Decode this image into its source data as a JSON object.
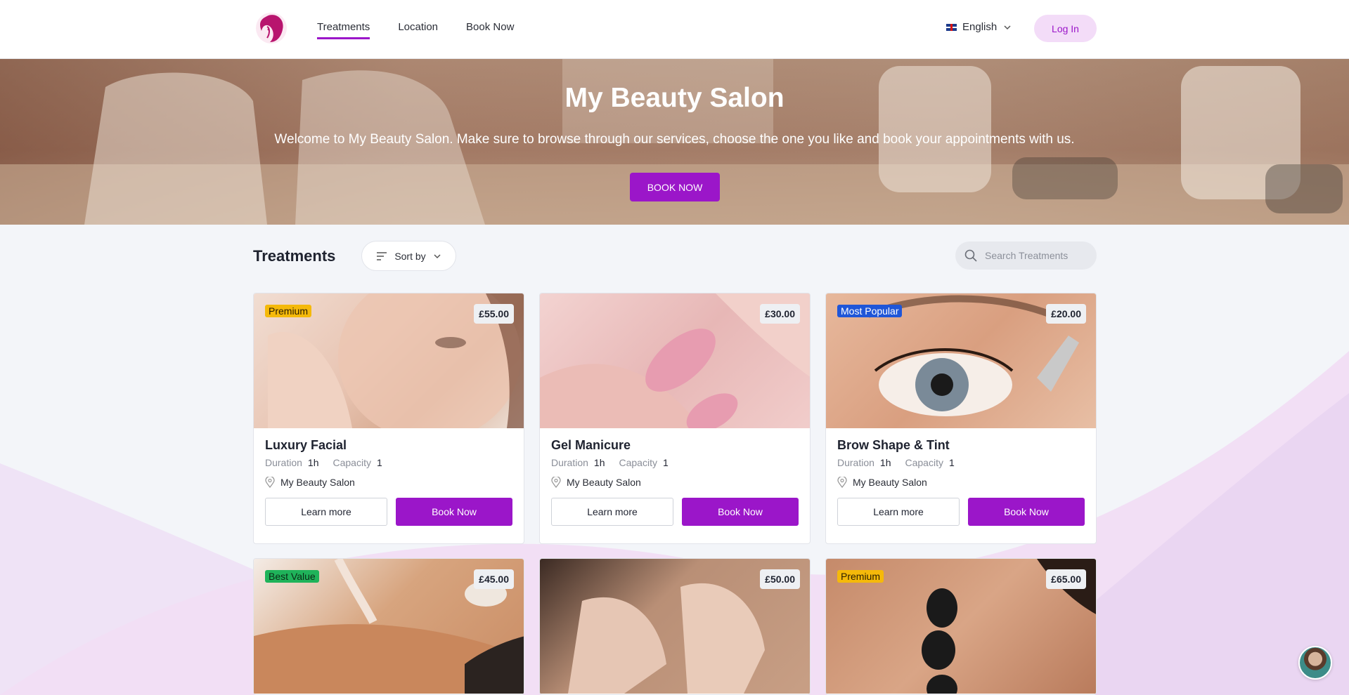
{
  "header": {
    "nav": [
      {
        "label": "Treatments",
        "active": true
      },
      {
        "label": "Location",
        "active": false
      },
      {
        "label": "Book Now",
        "active": false
      }
    ],
    "language": "English",
    "login_label": "Log In",
    "logo_icon": "woman-face-logo-icon"
  },
  "hero": {
    "title": "My Beauty Salon",
    "subtitle": "Welcome to My Beauty Salon. Make sure to browse through our services, choose the one you like and book your appointments with us.",
    "cta": "BOOK NOW"
  },
  "treatments": {
    "title": "Treatments",
    "sort_label": "Sort by",
    "search_placeholder": "Search Treatments",
    "cards": [
      {
        "name": "Luxury Facial",
        "price": "£55.00",
        "badge": "Premium",
        "badge_color": "#f5b90a",
        "duration_label": "Duration",
        "duration": "1h",
        "capacity_label": "Capacity",
        "capacity": "1",
        "location": "My Beauty Salon",
        "learn_label": "Learn more",
        "book_label": "Book Now"
      },
      {
        "name": "Gel Manicure",
        "price": "£30.00",
        "badge": "",
        "duration_label": "Duration",
        "duration": "1h",
        "capacity_label": "Capacity",
        "capacity": "1",
        "location": "My Beauty Salon",
        "learn_label": "Learn more",
        "book_label": "Book Now"
      },
      {
        "name": "Brow Shape & Tint",
        "price": "£20.00",
        "badge": "Most Popular",
        "badge_color": "#1f56d8",
        "duration_label": "Duration",
        "duration": "1h",
        "capacity_label": "Capacity",
        "capacity": "1",
        "location": "My Beauty Salon",
        "learn_label": "Learn more",
        "book_label": "Book Now"
      },
      {
        "name": "",
        "price": "£45.00",
        "badge": "Best Value",
        "badge_color": "#1fb35a"
      },
      {
        "name": "",
        "price": "£50.00",
        "badge": ""
      },
      {
        "name": "",
        "price": "£65.00",
        "badge": "Premium",
        "badge_color": "#f5b90a"
      }
    ]
  },
  "colors": {
    "accent": "#9b16c9",
    "accent_soft": "#f3dcf8"
  }
}
